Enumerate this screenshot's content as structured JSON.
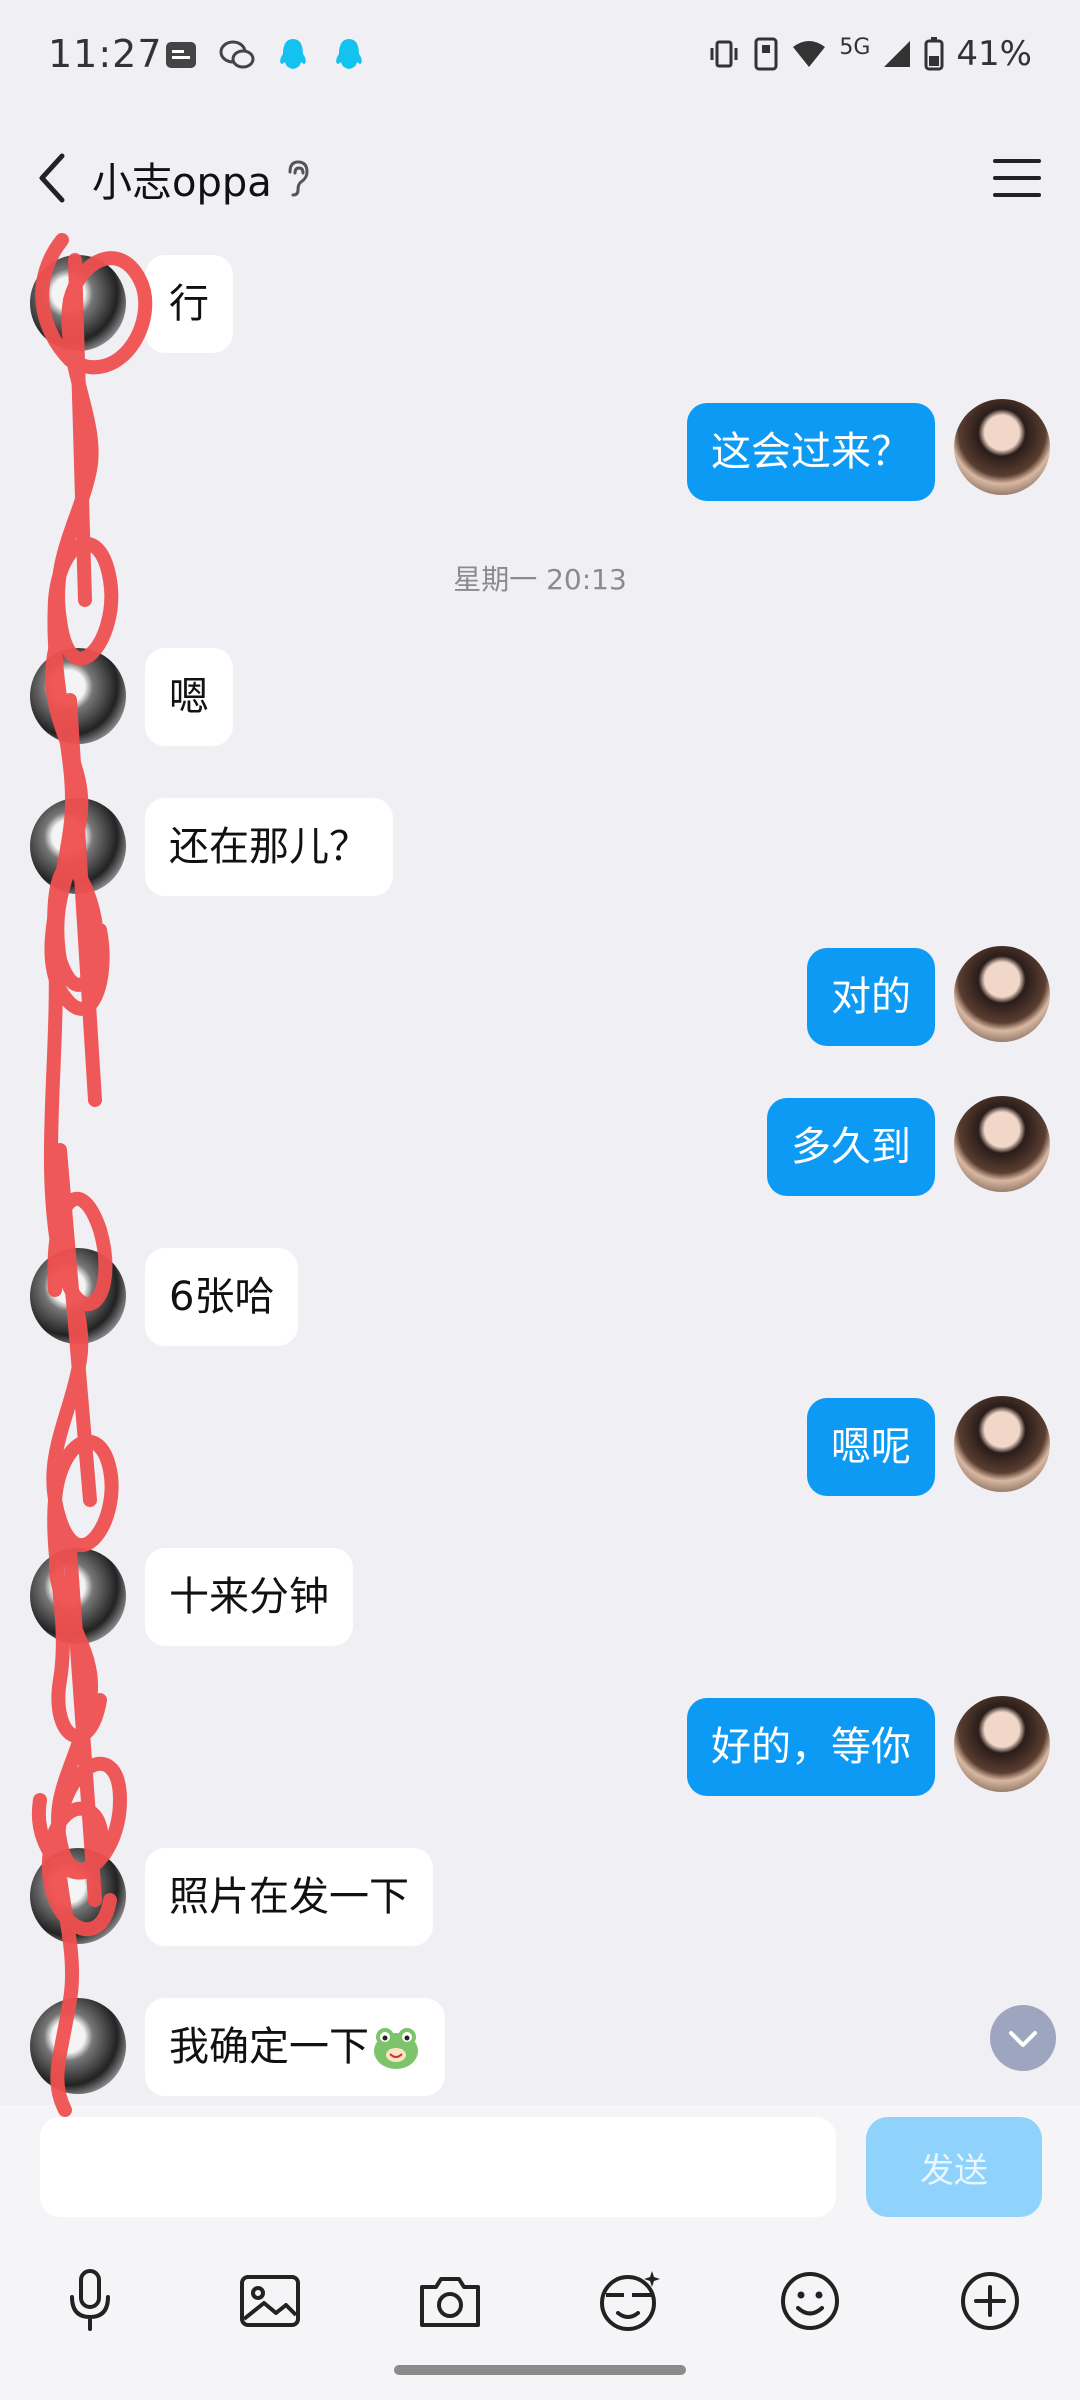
{
  "status_bar": {
    "time": "11:27",
    "network": "5G",
    "battery": "41%"
  },
  "header": {
    "title": "小志oppa"
  },
  "messages": [
    {
      "side": "in",
      "text": "行"
    },
    {
      "side": "out",
      "text": "这会过来？"
    },
    {
      "timestamp": "星期一 20:13"
    },
    {
      "side": "in",
      "text": "嗯"
    },
    {
      "side": "in",
      "text": "还在那儿？"
    },
    {
      "side": "out",
      "text": "对的"
    },
    {
      "side": "out",
      "text": "多久到"
    },
    {
      "side": "in",
      "text": "6张哈"
    },
    {
      "side": "out",
      "text": "嗯呢"
    },
    {
      "side": "in",
      "text": "十来分钟"
    },
    {
      "side": "out",
      "text": "好的，等你"
    },
    {
      "side": "in",
      "text": "照片在发一下"
    },
    {
      "side": "in",
      "text": "我确定一下",
      "emoji": "frog-emoji"
    }
  ],
  "input": {
    "value": "",
    "send_label": "发送"
  },
  "toolbar": {
    "icons": [
      "microphone-icon",
      "image-icon",
      "camera-icon",
      "sticker-icon",
      "emoji-icon",
      "plus-icon"
    ]
  },
  "colors": {
    "outgoing_bubble": "#0c9af4",
    "incoming_bubble": "#ffffff",
    "background": "#efeff4",
    "send_button_disabled": "#8fd2fb",
    "scribble": "#f05050"
  }
}
